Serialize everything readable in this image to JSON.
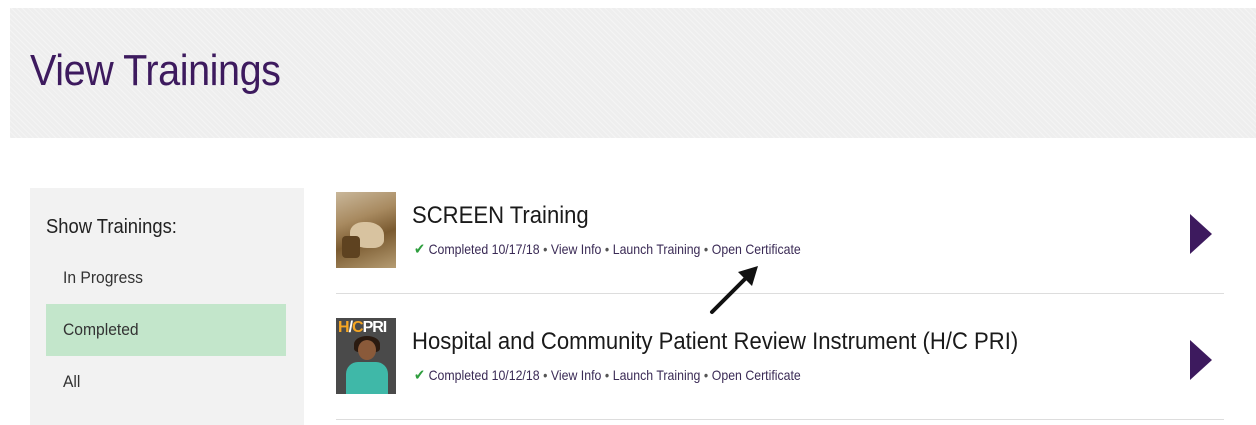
{
  "header": {
    "title": "View Trainings"
  },
  "sidebar": {
    "heading": "Show Trainings:",
    "filters": [
      {
        "label": "In Progress",
        "active": false
      },
      {
        "label": "Completed",
        "active": true
      },
      {
        "label": "All",
        "active": false
      }
    ]
  },
  "trainings": [
    {
      "title": "SCREEN Training",
      "status": "Completed 10/17/18",
      "view_info": "View Info",
      "launch": "Launch Training",
      "certificate": "Open Certificate",
      "thumbnail": "hands-photo"
    },
    {
      "title": "Hospital and Community Patient Review Instrument (H/C PRI)",
      "status": "Completed 10/12/18",
      "view_info": "View Info",
      "launch": "Launch Training",
      "certificate": "Open Certificate",
      "thumbnail": "hcpri-logo",
      "thumb_text": {
        "h": "H",
        "slash": "/",
        "c": "C",
        "pri": "PRI"
      }
    }
  ],
  "separator": "•",
  "icons": {
    "status": "check-icon",
    "open": "chevron-right-icon"
  },
  "colors": {
    "brand": "#3d1a5e",
    "active_filter": "#c3e6cb",
    "check": "#2e9e3e"
  }
}
